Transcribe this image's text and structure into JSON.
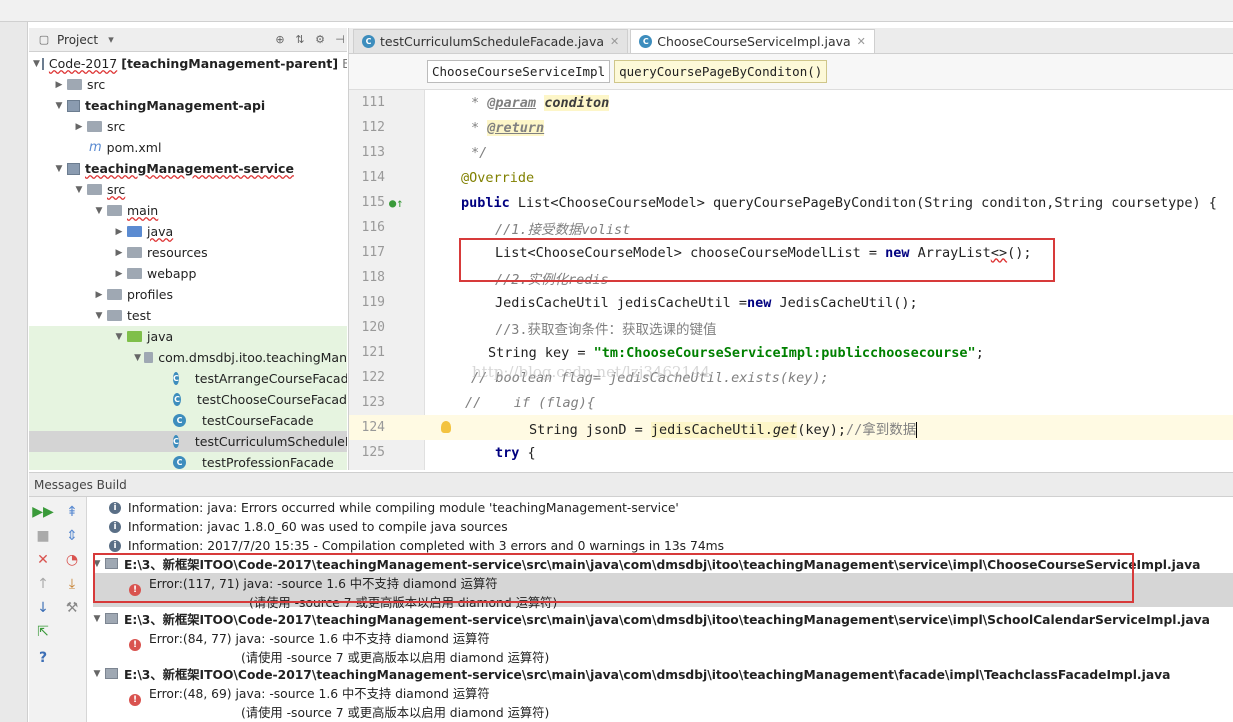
{
  "project_panel": {
    "title": "Project",
    "tree": [
      {
        "label": "Code-2017",
        "suffix": "[teachingManagement-parent]",
        "path_hint": "E:"
      },
      {
        "label": "src"
      },
      {
        "label": "teachingManagement-api"
      },
      {
        "label": "src"
      },
      {
        "label": "pom.xml"
      },
      {
        "label": "teachingManagement-service"
      },
      {
        "label": "src"
      },
      {
        "label": "main"
      },
      {
        "label": "java"
      },
      {
        "label": "resources"
      },
      {
        "label": "webapp"
      },
      {
        "label": "profiles"
      },
      {
        "label": "test"
      },
      {
        "label": "java"
      },
      {
        "label": "com.dmsdbj.itoo.teachingMan"
      },
      {
        "label": "testArrangeCourseFacad"
      },
      {
        "label": "testChooseCourseFacad"
      },
      {
        "label": "testCourseFacade"
      },
      {
        "label": "testCurriculumScheduleF"
      },
      {
        "label": "testProfessionFacade"
      }
    ]
  },
  "editor": {
    "tabs": [
      {
        "label": "testCurriculumScheduleFacade.java"
      },
      {
        "label": "ChooseCourseServiceImpl.java"
      }
    ],
    "breadcrumbs": [
      "ChooseCourseServiceImpl",
      "queryCoursePageByConditon()"
    ],
    "line_numbers": [
      "111",
      "112",
      "113",
      "114",
      "115",
      "116",
      "117",
      "118",
      "119",
      "120",
      "121",
      "122",
      "123",
      "124",
      "125"
    ],
    "code": {
      "l111_star": "* ",
      "l111_tag": "@param",
      "l111_arg": "conditon",
      "l112_star": "* ",
      "l112_tag": "@return",
      "l113": "*/",
      "l114": "@Override",
      "l115_kw": "public",
      "l115_rest": " List<ChooseCourseModel> queryCoursePageByConditon(String conditon,String coursetype) {",
      "l116": "//1.接受数据volist",
      "l117_a": "List<ChooseCourseModel> chooseCourseModelList = ",
      "l117_kw": "new",
      "l117_b": " ArrayList",
      "l117_c": "<>",
      "l117_d": "();",
      "l118": "//2.实例化redis",
      "l119_a": "JedisCacheUtil jedisCacheUtil =",
      "l119_kw": "new",
      "l119_b": " JedisCacheUtil();",
      "l120": "//3.获取查询条件：获取选课的键值",
      "l121_a": "String key = ",
      "l121_str": "\"tm:ChooseCourseServiceImpl:publicchoosecourse\"",
      "l121_b": ";",
      "l122": "// boolean flag= jedisCacheUtil.exists(key);",
      "l123": "//    if (flag){",
      "l124_a": "String jsonD = ",
      "l124_var": "jedisCacheUtil.",
      "l124_m": "get",
      "l124_b": "(key);",
      "l124_c": "//拿到数据",
      "l125_kw": "try",
      "l125_b": " {"
    },
    "watermark": "http://blog.csdn.net/lzj3462144"
  },
  "messages": {
    "title": "Messages Build",
    "lines": [
      {
        "kind": "info",
        "text": "Information: java: Errors occurred while compiling module 'teachingManagement-service'"
      },
      {
        "kind": "info",
        "text": "Information: javac 1.8.0_60 was used to compile java sources"
      },
      {
        "kind": "info",
        "text": "Information: 2017/7/20 15:35 - Compilation completed with 3 errors and 0 warnings in 13s 74ms"
      },
      {
        "kind": "file",
        "text": "E:\\3、新框架ITOO\\Code-2017\\teachingManagement-service\\src\\main\\java\\com\\dmsdbj\\itoo\\teachingManagement\\service\\impl\\ChooseCourseServiceImpl.java"
      },
      {
        "kind": "error",
        "text": "Error:(117, 71)  java: -source 1.6 中不支持 diamond 运算符"
      },
      {
        "kind": "hint",
        "text": "(请使用 -source 7 或更高版本以启用 diamond 运算符)"
      },
      {
        "kind": "file",
        "text": "E:\\3、新框架ITOO\\Code-2017\\teachingManagement-service\\src\\main\\java\\com\\dmsdbj\\itoo\\teachingManagement\\service\\impl\\SchoolCalendarServiceImpl.java"
      },
      {
        "kind": "error",
        "text": "Error:(84, 77)  java: -source 1.6 中不支持 diamond 运算符"
      },
      {
        "kind": "hint",
        "text": "(请使用 -source 7 或更高版本以启用 diamond 运算符)"
      },
      {
        "kind": "file",
        "text": "E:\\3、新框架ITOO\\Code-2017\\teachingManagement-service\\src\\main\\java\\com\\dmsdbj\\itoo\\teachingManagement\\facade\\impl\\TeachclassFacadeImpl.java"
      },
      {
        "kind": "error",
        "text": "Error:(48, 69)  java: -source 1.6 中不支持 diamond 运算符"
      },
      {
        "kind": "hint",
        "text": "(请使用 -source 7 或更高版本以启用 diamond 运算符)"
      }
    ]
  },
  "colors": {
    "highlight_box": "#d73a3a",
    "keyword": "#000080",
    "string": "#008000",
    "comment": "#808080",
    "annotation": "#808000"
  }
}
